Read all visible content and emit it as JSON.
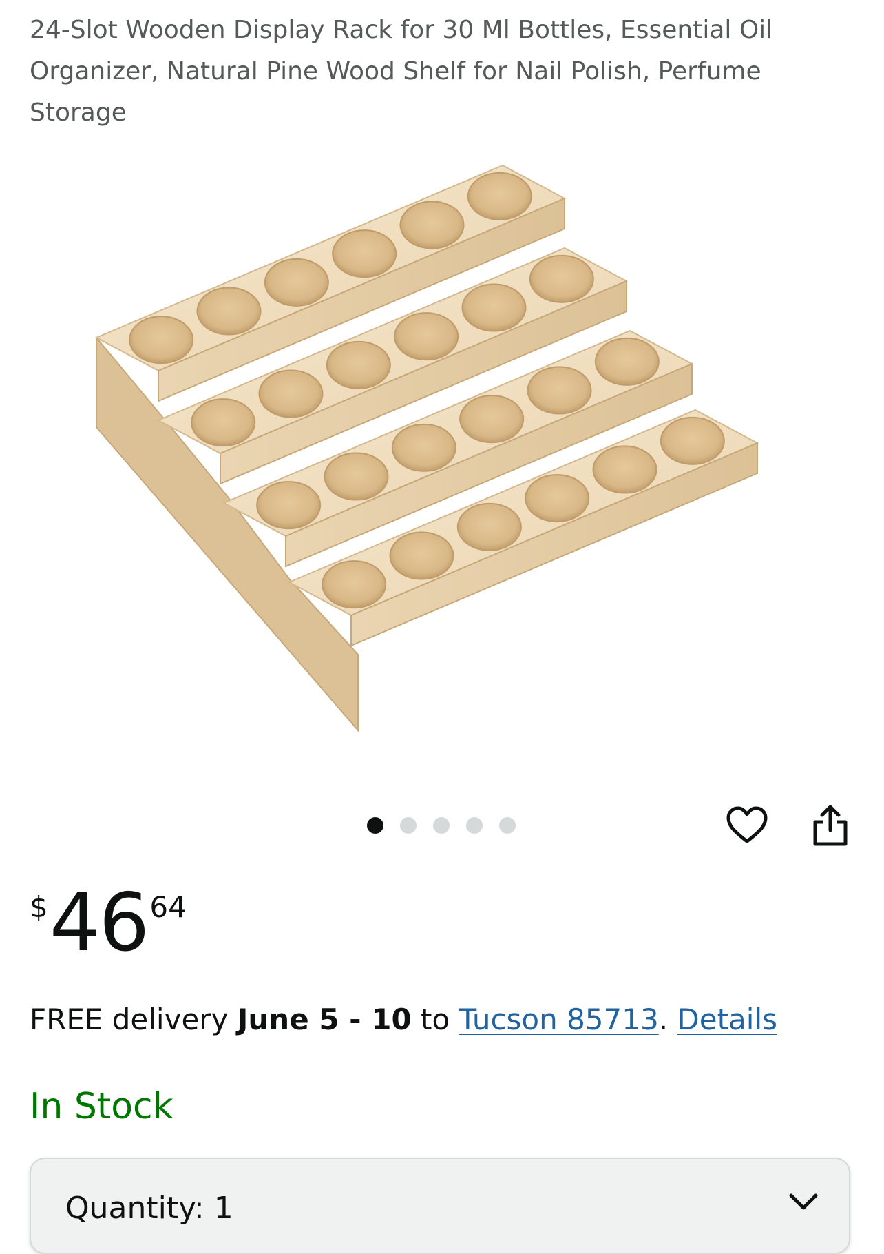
{
  "product": {
    "title": "24-Slot Wooden Display Rack for 30 Ml Bottles, Essential Oil Organizer, Natural Pine Wood Shelf for Nail Polish, Perfume Storage",
    "image_alt": "Four-tier natural pine wood display rack with 24 round bottle slots",
    "carousel": {
      "count": 5,
      "active_index": 0
    }
  },
  "icons": {
    "wishlist": "heart-icon",
    "share": "share-icon",
    "quantity": "chevron-down-icon"
  },
  "price": {
    "currency": "$",
    "whole": "46",
    "fraction": "64"
  },
  "delivery": {
    "prefix": "FREE delivery ",
    "dates": "June 5 - 10",
    "to": " to ",
    "location": "Tucson 85713",
    "period": ". ",
    "details_link": "Details"
  },
  "availability": {
    "text": "In Stock",
    "color": "#007600"
  },
  "quantity": {
    "label": "Quantity:",
    "value": "1"
  },
  "colors": {
    "link": "#2162a1",
    "title": "#565959",
    "text": "#0f1111"
  }
}
